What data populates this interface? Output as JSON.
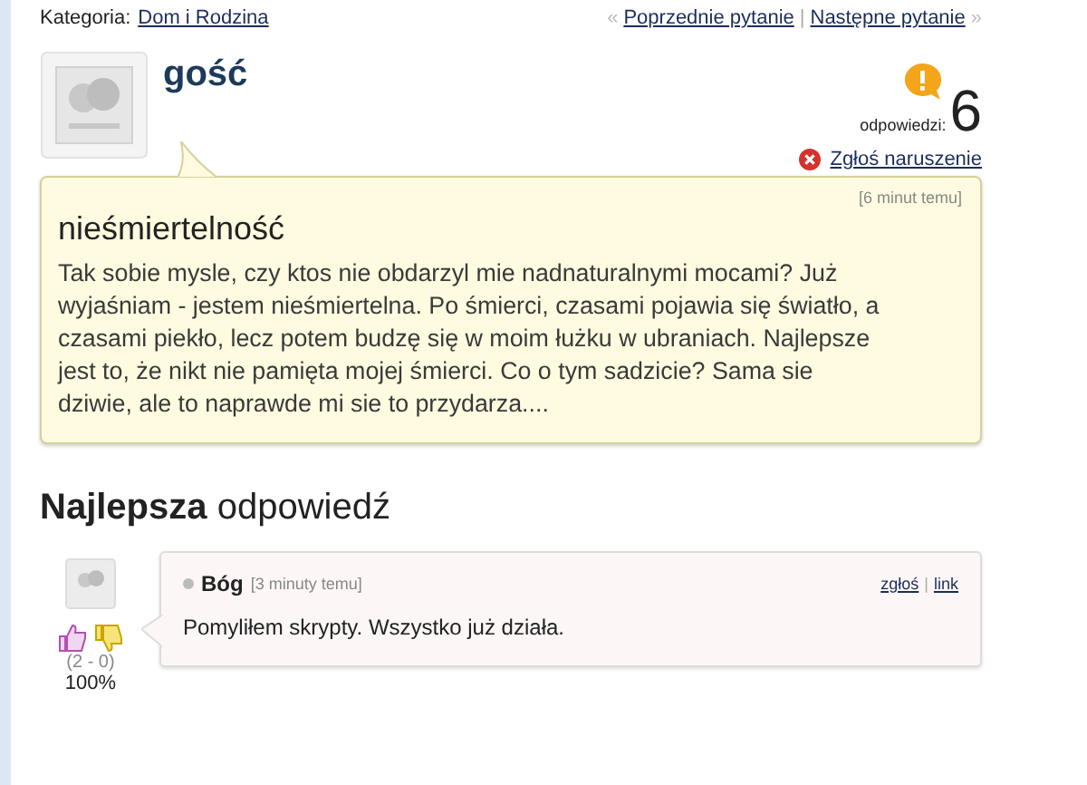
{
  "breadcrumb": {
    "label": "Kategoria:",
    "category": "Dom i Rodzina"
  },
  "nav": {
    "prev_mark": "«",
    "previous": "Poprzednie pytanie",
    "separator": "|",
    "next": "Następne pytanie",
    "next_mark": "»"
  },
  "question": {
    "author": "gość",
    "answers_label": "odpowiedzi:",
    "answers_count": "6",
    "report": "Zgłoś naruszenie",
    "time": "[6 minut temu]",
    "title": "nieśmiertelność",
    "body": "Tak sobie mysle, czy ktos nie obdarzyl mie nadnaturalnymi mocami? Już wyjaśniam - jestem nieśmiertelna. Po śmierci, czasami pojawia się światło, a czasami piekło, lecz potem budzę się w moim łużku w ubraniach. Najlepsze jest to, że nikt nie pamięta mojej śmierci. Co o tym sadzicie? Sama sie dziwie, ale to naprawde mi sie to przydarza...."
  },
  "best_answer": {
    "heading": "**Najlepsza** odpowiedź",
    "author": "Bóg",
    "time": "[3 minuty temu]",
    "report": "zgłoś",
    "separator": "|",
    "link": "link",
    "body": "Pomyliłem skrypty. Wszystko już działa.",
    "votes": "(2 - 0)",
    "percent": "100%"
  }
}
